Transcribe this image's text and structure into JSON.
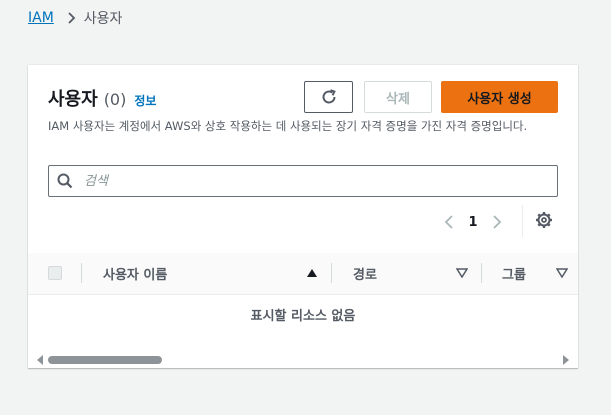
{
  "breadcrumb": {
    "root": "IAM",
    "current": "사용자"
  },
  "panel": {
    "title": "사용자",
    "count": "(0)",
    "info_link": "정보",
    "description": "IAM 사용자는 계정에서 AWS와 상호 작용하는 데 사용되는 장기 자격 증명을 가진 자격 증명입니다.",
    "buttons": {
      "refresh_icon": "refresh-icon",
      "delete_label": "삭제",
      "create_label": "사용자 생성"
    },
    "search": {
      "placeholder": "검색",
      "value": ""
    },
    "pagination": {
      "current_page": "1"
    }
  },
  "table": {
    "columns": [
      {
        "label": "사용자 이름",
        "sort": "ascending"
      },
      {
        "label": "경로",
        "sort": "none"
      },
      {
        "label": "그룹",
        "sort": "none"
      }
    ],
    "empty_message": "표시할 리소스 없음"
  },
  "colors": {
    "link": "#0073bb",
    "primary_button": "#ec7211",
    "page_background": "#f2f3f3",
    "text": "#16191f",
    "secondary_text": "#545b64",
    "disabled_text": "#aab7b8"
  },
  "icons": [
    "chevron-right-icon",
    "refresh-icon",
    "search-icon",
    "chevron-left-icon",
    "settings-icon",
    "sort-ascending-icon",
    "sort-descending-icon",
    "scroll-left-icon",
    "scroll-right-icon"
  ]
}
